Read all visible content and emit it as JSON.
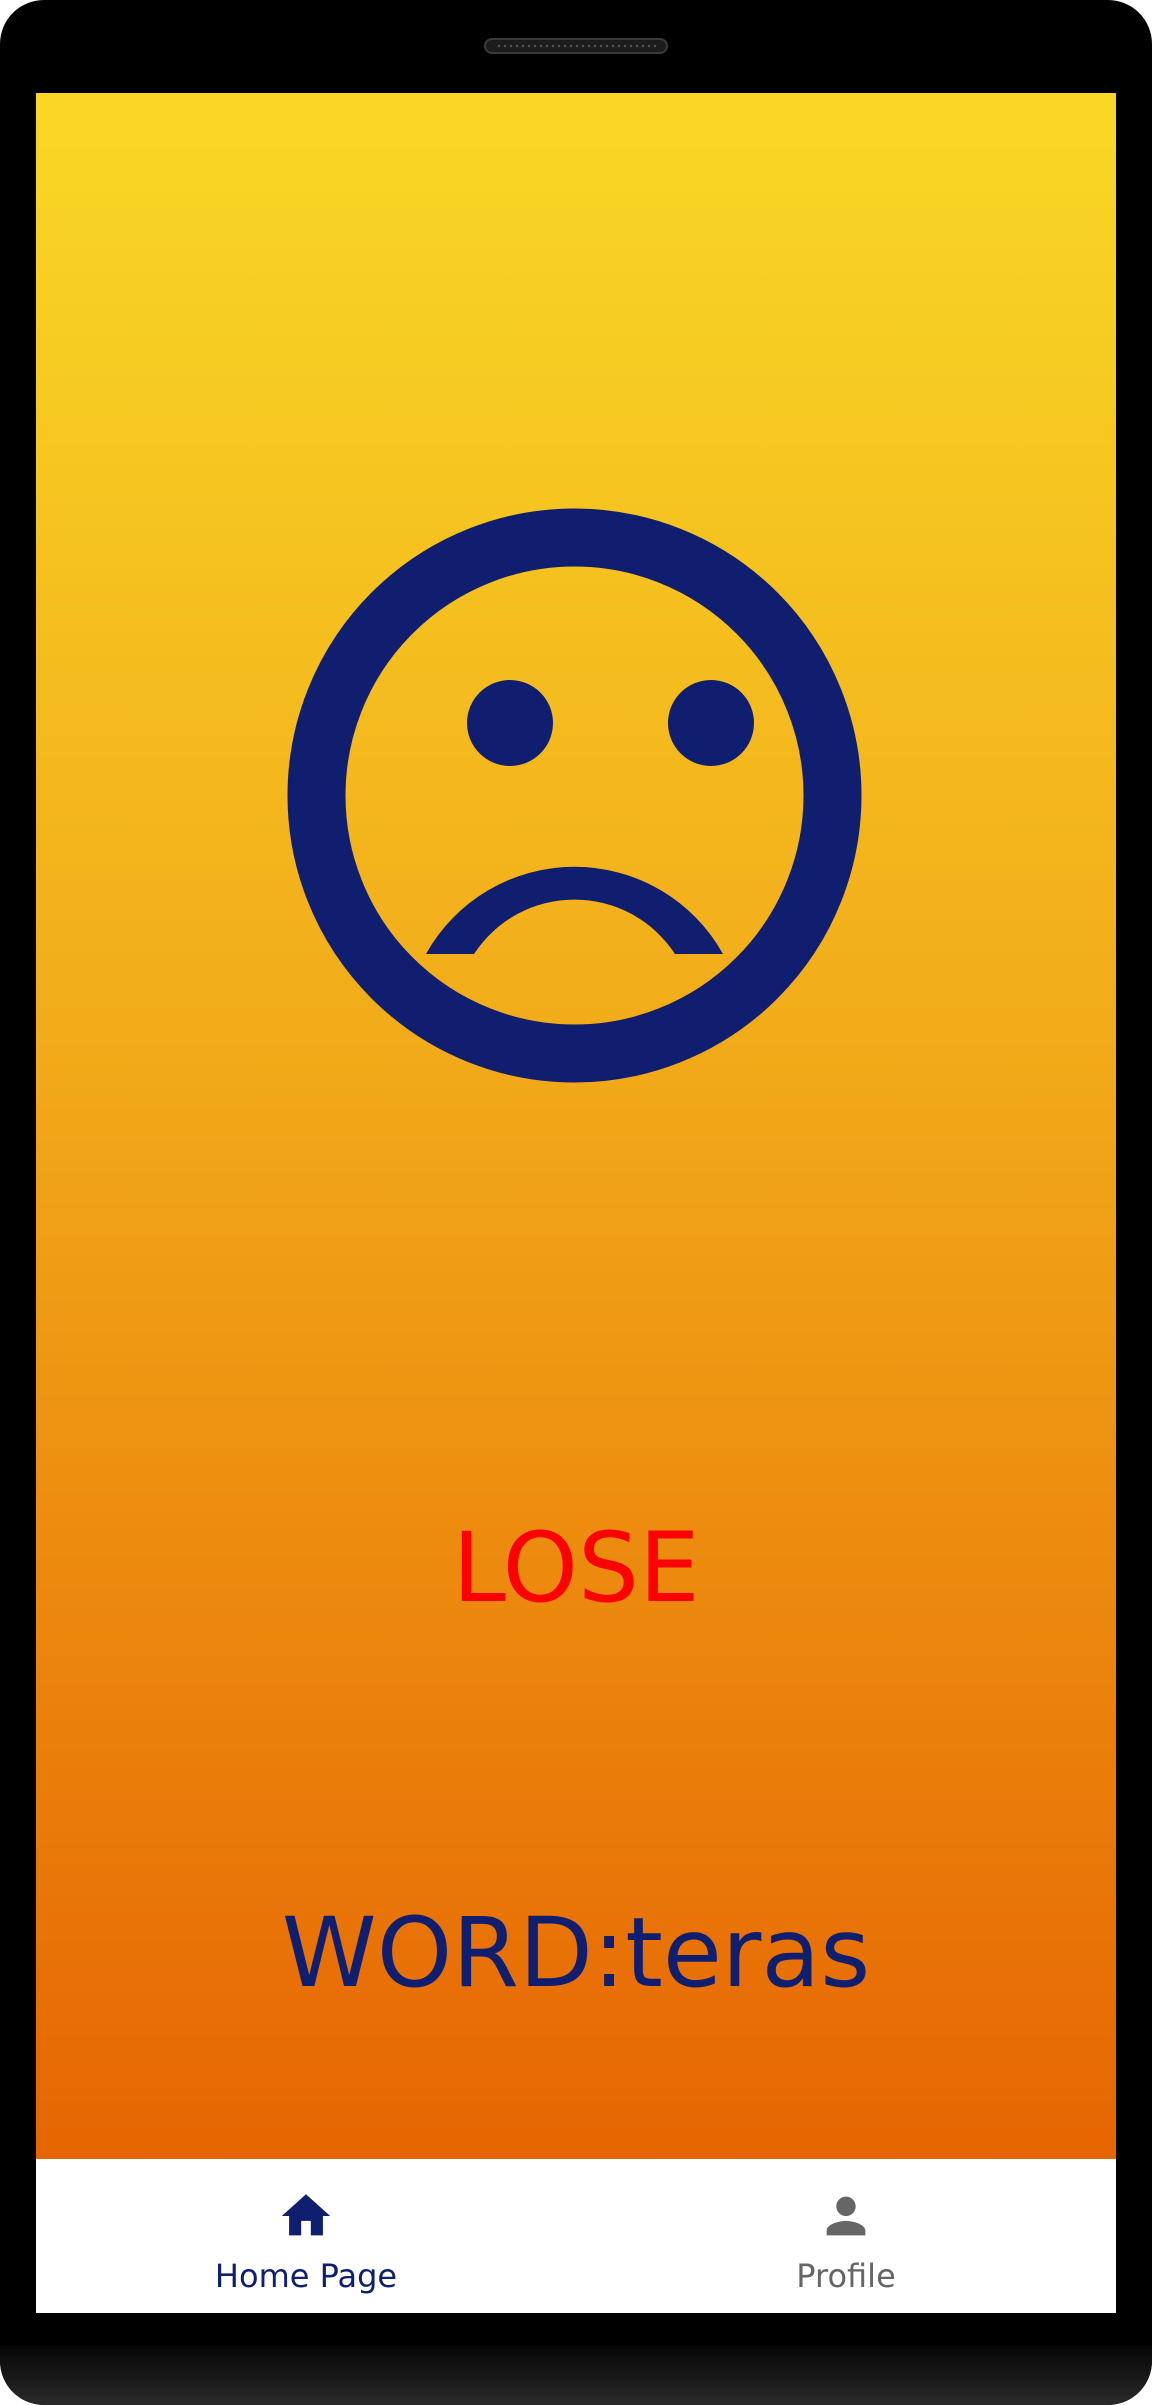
{
  "game": {
    "result_label": "LOSE",
    "word_label": "WORD:teras",
    "face_icon": "sad-face-icon",
    "colors": {
      "gradient_top": "#f8d825",
      "gradient_bottom": "#e66502",
      "face": "#0f1e6e",
      "result_text": "#ff0000",
      "word_text": "#0f1e6e"
    }
  },
  "bottom_nav": {
    "items": [
      {
        "label": "Home Page",
        "icon": "home-icon",
        "active": true
      },
      {
        "label": "Profile",
        "icon": "person-icon",
        "active": false
      }
    ],
    "active_color": "#0f1e6e",
    "inactive_color": "#666666"
  }
}
